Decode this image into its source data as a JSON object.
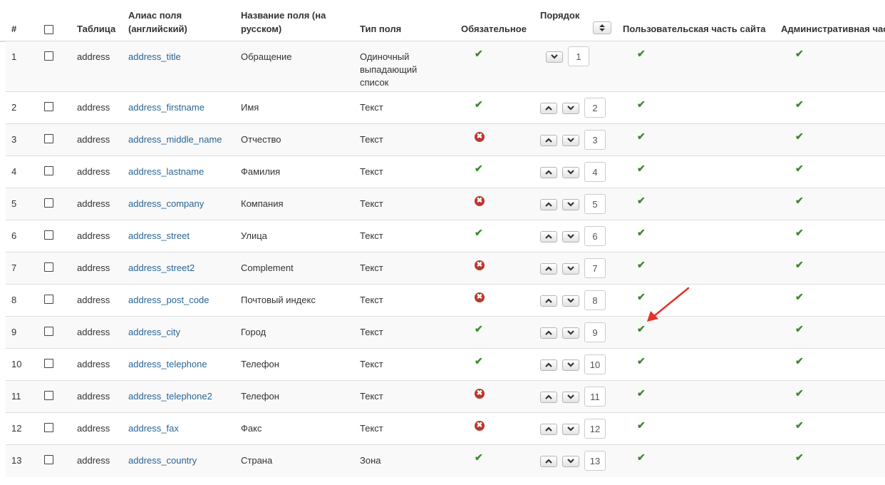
{
  "header": {
    "num": "#",
    "table": "Таблица",
    "alias_line1": "Алиас поля",
    "alias_line2": "(английский)",
    "name_line1": "Название поля (на",
    "name_line2": "русском)",
    "type": "Тип поля",
    "required": "Обязательное",
    "order": "Порядок",
    "order_sort_icon": "sort-updown-icon",
    "frontend": "Пользовательская часть сайта",
    "admin": "Административная час"
  },
  "status_icons": {
    "yes": "check-icon",
    "no": "cross-circle-icon"
  },
  "colors": {
    "check": "#3c8a2e",
    "cross": "#bd362f",
    "link": "#2a6496",
    "arrow": "#e8302b"
  },
  "rows": [
    {
      "num": "1",
      "table": "address",
      "alias": "address_title",
      "name": "Обращение",
      "type_lines": [
        "Одиночный",
        "выпадающий",
        "список"
      ],
      "required": true,
      "order": "1",
      "frontend": true,
      "admin": true
    },
    {
      "num": "2",
      "table": "address",
      "alias": "address_firstname",
      "name": "Имя",
      "type_lines": [
        "Текст"
      ],
      "required": true,
      "order": "2",
      "frontend": true,
      "admin": true
    },
    {
      "num": "3",
      "table": "address",
      "alias": "address_middle_name",
      "name": "Отчество",
      "type_lines": [
        "Текст"
      ],
      "required": false,
      "order": "3",
      "frontend": true,
      "admin": true
    },
    {
      "num": "4",
      "table": "address",
      "alias": "address_lastname",
      "name": "Фамилия",
      "type_lines": [
        "Текст"
      ],
      "required": true,
      "order": "4",
      "frontend": true,
      "admin": true
    },
    {
      "num": "5",
      "table": "address",
      "alias": "address_company",
      "name": "Компания",
      "type_lines": [
        "Текст"
      ],
      "required": false,
      "order": "5",
      "frontend": true,
      "admin": true
    },
    {
      "num": "6",
      "table": "address",
      "alias": "address_street",
      "name": "Улица",
      "type_lines": [
        "Текст"
      ],
      "required": true,
      "order": "6",
      "frontend": true,
      "admin": true
    },
    {
      "num": "7",
      "table": "address",
      "alias": "address_street2",
      "name": "Complement",
      "type_lines": [
        "Текст"
      ],
      "required": false,
      "order": "7",
      "frontend": true,
      "admin": true
    },
    {
      "num": "8",
      "table": "address",
      "alias": "address_post_code",
      "name": "Почтовый индекс",
      "type_lines": [
        "Текст"
      ],
      "required": false,
      "order": "8",
      "frontend": true,
      "admin": true
    },
    {
      "num": "9",
      "table": "address",
      "alias": "address_city",
      "name": "Город",
      "type_lines": [
        "Текст"
      ],
      "required": true,
      "order": "9",
      "frontend": true,
      "admin": true
    },
    {
      "num": "10",
      "table": "address",
      "alias": "address_telephone",
      "name": "Телефон",
      "type_lines": [
        "Текст"
      ],
      "required": true,
      "order": "10",
      "frontend": true,
      "admin": true
    },
    {
      "num": "11",
      "table": "address",
      "alias": "address_telephone2",
      "name": "Телефон",
      "type_lines": [
        "Текст"
      ],
      "required": false,
      "order": "11",
      "frontend": true,
      "admin": true
    },
    {
      "num": "12",
      "table": "address",
      "alias": "address_fax",
      "name": "Факс",
      "type_lines": [
        "Текст"
      ],
      "required": false,
      "order": "12",
      "frontend": true,
      "admin": true
    },
    {
      "num": "13",
      "table": "address",
      "alias": "address_country",
      "name": "Страна",
      "type_lines": [
        "Зона"
      ],
      "required": true,
      "order": "13",
      "frontend": true,
      "admin": true
    }
  ]
}
